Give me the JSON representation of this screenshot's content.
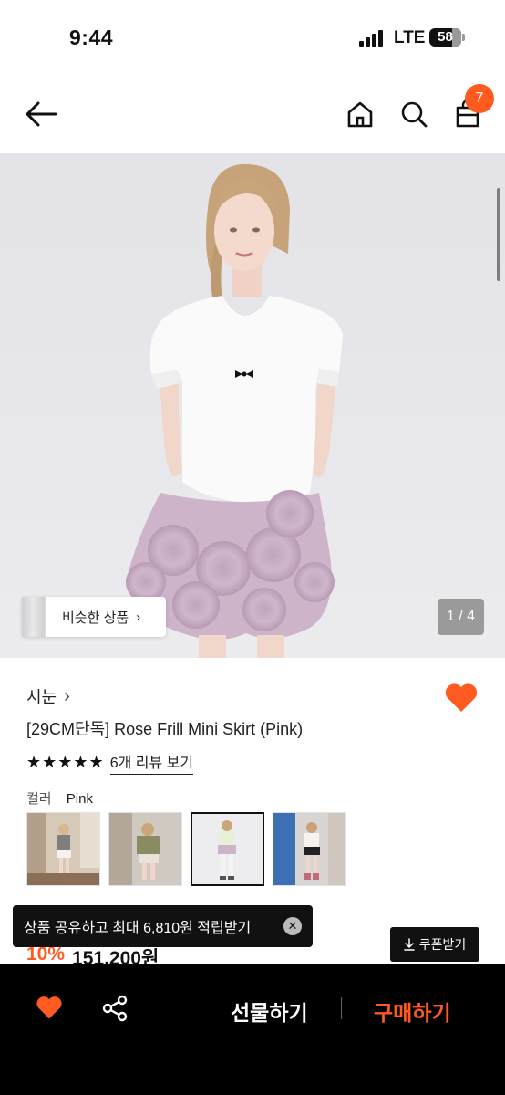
{
  "status_bar": {
    "time": "9:44",
    "network": "LTE",
    "battery": "58"
  },
  "nav": {
    "cart_count": "7"
  },
  "hero": {
    "similar_button": "비슷한 상품",
    "page_indicator": "1 / 4"
  },
  "product": {
    "brand": "시눈",
    "title": "[29CM단독] Rose Frill Mini Skirt (Pink)",
    "stars": "★★★★★",
    "review_link": "6개 리뷰 보기",
    "color_label": "컬러",
    "color_value": "Pink",
    "discount": "10%",
    "price": "151,200원"
  },
  "toast": {
    "message": "상품 공유하고 최대 6,810원 적립받기",
    "close_icon": "close-icon"
  },
  "coupon_button": "쿠폰받기",
  "bottom_bar": {
    "gift_label": "선물하기",
    "buy_label": "구매하기"
  },
  "colors": {
    "accent": "#ff5a1f",
    "black": "#000000"
  }
}
